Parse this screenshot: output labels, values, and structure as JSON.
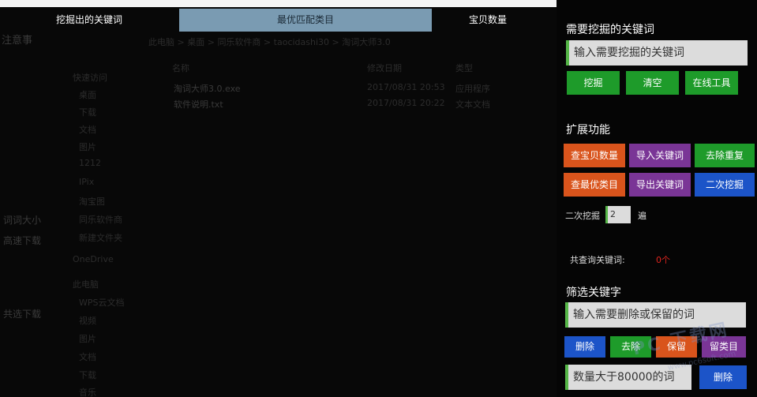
{
  "results_table": {
    "columns": [
      "挖掘出的关键词",
      "最优匹配类目",
      "宝贝数量"
    ]
  },
  "background_ghost": {
    "left_fragments": [
      "注意事",
      "词 ",
      "词词大小",
      "高速下载",
      "共选下载"
    ],
    "breadcrumb": [
      "此电脑",
      "桌面",
      "同乐软件商",
      "taocidashi30",
      "淘词大师3.0"
    ],
    "quick_access": "快速访问",
    "nav_items": [
      "桌面",
      "下载",
      "文档",
      "图片",
      "1212",
      "IPix",
      "淘宝图",
      "同乐软件商",
      "新建文件夹"
    ],
    "onedrive": "OneDrive",
    "this_pc": "此电脑",
    "pc_items": [
      "WPS云文档",
      "视频",
      "图片",
      "文档",
      "下载",
      "音乐"
    ],
    "list_header": [
      "名称",
      "修改日期",
      "类型"
    ],
    "files": [
      {
        "name": "淘词大师3.0.exe",
        "date": "2017/08/31 20:53",
        "type": "应用程序"
      },
      {
        "name": "软件说明.txt",
        "date": "2017/08/31 20:22",
        "type": "文本文档"
      }
    ]
  },
  "panel": {
    "keyword_section_title": "需要挖掘的关键词",
    "keyword_placeholder": "输入需要挖掘的关键词",
    "mine_button": "挖掘",
    "clear_button": "清空",
    "online_tools_button": "在线工具",
    "extend_title": "扩展功能",
    "check_count_button": "查宝贝数量",
    "import_button": "导入关键词",
    "dedupe_button": "去除重复",
    "best_category_button": "查最优类目",
    "export_button": "导出关键词",
    "second_mine_button": "二次挖掘",
    "second_mine_label": "二次挖掘",
    "second_mine_value": "2",
    "times_label": "遍",
    "total_label": "共查询关键词:",
    "total_value": "0个",
    "filter_title": "筛选关键字",
    "filter_placeholder": "输入需要删除或保留的词",
    "delete_button": "删除",
    "remove_button": "去除",
    "keep_button": "保留",
    "keep_category_button": "留类目",
    "quantity_filter": "数量大于80000的词",
    "quantity_delete_button": "删除"
  },
  "watermark": {
    "main": "PC 下载网",
    "sub": "www.pc6soft.com"
  },
  "colors": {
    "green": "#1e9b2a",
    "orange": "#d9541c",
    "purple": "#7a3596",
    "blue": "#1c54c8",
    "header_highlight": "#7a9bb2",
    "count_red": "#e0241e"
  }
}
